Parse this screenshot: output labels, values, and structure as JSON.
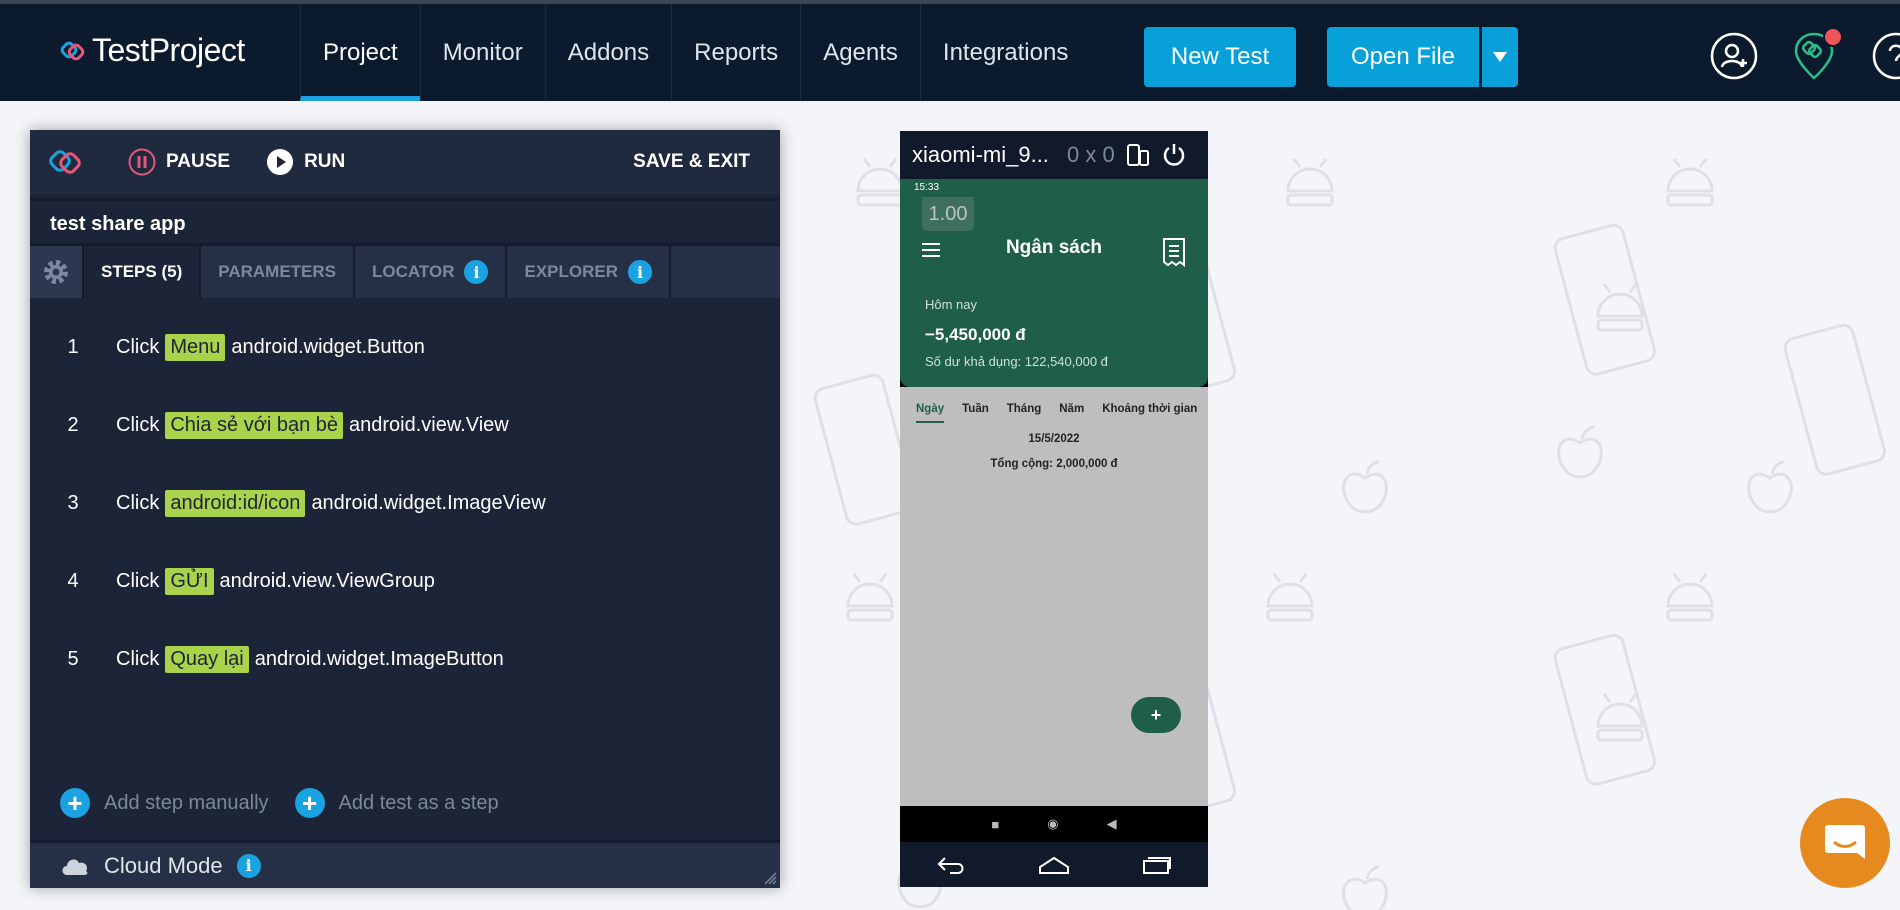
{
  "brand": {
    "name": "TestProject"
  },
  "nav": {
    "tabs": [
      "Project",
      "Monitor",
      "Addons",
      "Reports",
      "Agents",
      "Integrations"
    ],
    "active": "Project",
    "new_test": "New Test",
    "open_file": "Open File"
  },
  "recorder": {
    "pause": "PAUSE",
    "run": "RUN",
    "save_exit": "SAVE & EXIT",
    "test_name": "test share app",
    "tabs": {
      "steps": "STEPS (5)",
      "parameters": "PARAMETERS",
      "locator": "LOCATOR",
      "explorer": "EXPLORER"
    },
    "steps": [
      {
        "num": "1",
        "action": "Click",
        "target": "Menu",
        "type": "android.widget.Button"
      },
      {
        "num": "2",
        "action": "Click",
        "target": "Chia sẻ với bạn bè",
        "type": "android.view.View"
      },
      {
        "num": "3",
        "action": "Click",
        "target": "android:id/icon",
        "type": "android.widget.ImageView"
      },
      {
        "num": "4",
        "action": "Click",
        "target": "GỬI",
        "type": "android.view.ViewGroup"
      },
      {
        "num": "5",
        "action": "Click",
        "target": "Quay lại",
        "type": "android.widget.ImageButton"
      }
    ],
    "add_step": "Add step manually",
    "add_test": "Add test as a step",
    "cloud_mode": "Cloud Mode"
  },
  "device": {
    "name": "xiaomi-mi_9...",
    "dimensions": "0 x 0",
    "status_time": "15:33",
    "zoom": "1.00",
    "app_title": "Ngân sách",
    "today_label": "Hôm nay",
    "amount": "−5,450,000 đ",
    "balance": "Số dư khả dụng: 122,540,000 đ",
    "periods": [
      "Ngày",
      "Tuần",
      "Tháng",
      "Năm",
      "Khoảng thời gian"
    ],
    "date": "15/5/2022",
    "total": "Tổng cộng: 2,000,000 đ",
    "fab": "+"
  },
  "colors": {
    "nav_bg": "#0b1a2c",
    "accent": "#07a0d8",
    "panel_bg": "#1c2438",
    "highlight": "#a9d34a",
    "app_green": "#1f5f49",
    "chat_orange": "#e68a1f",
    "notification_red": "#f0555a"
  }
}
